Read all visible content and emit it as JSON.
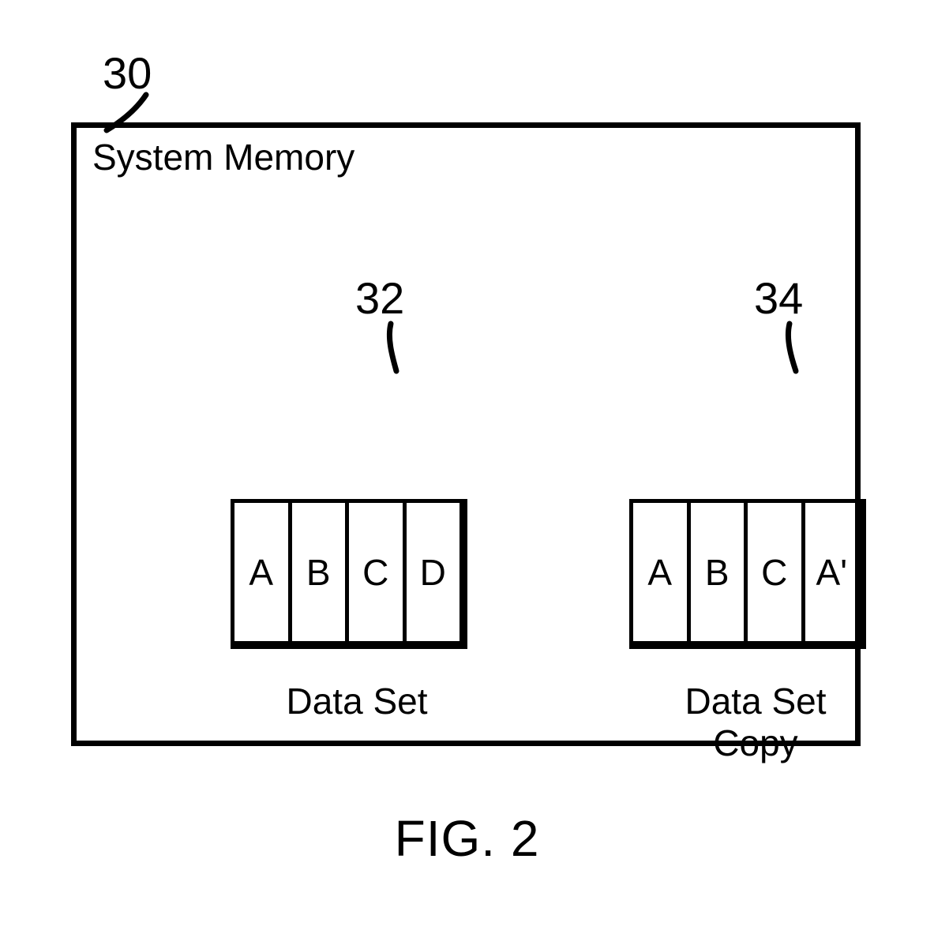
{
  "refs": {
    "outer": "30",
    "data_set": "32",
    "data_set_copy": "34"
  },
  "outer": {
    "title": "System Memory"
  },
  "data_set": {
    "label": "Data Set",
    "cells": [
      "A",
      "B",
      "C",
      "D"
    ]
  },
  "data_set_copy": {
    "label_line1": "Data Set",
    "label_line2": "Copy",
    "cells": [
      "A",
      "B",
      "C",
      "A'"
    ]
  },
  "figure_caption": "FIG. 2"
}
